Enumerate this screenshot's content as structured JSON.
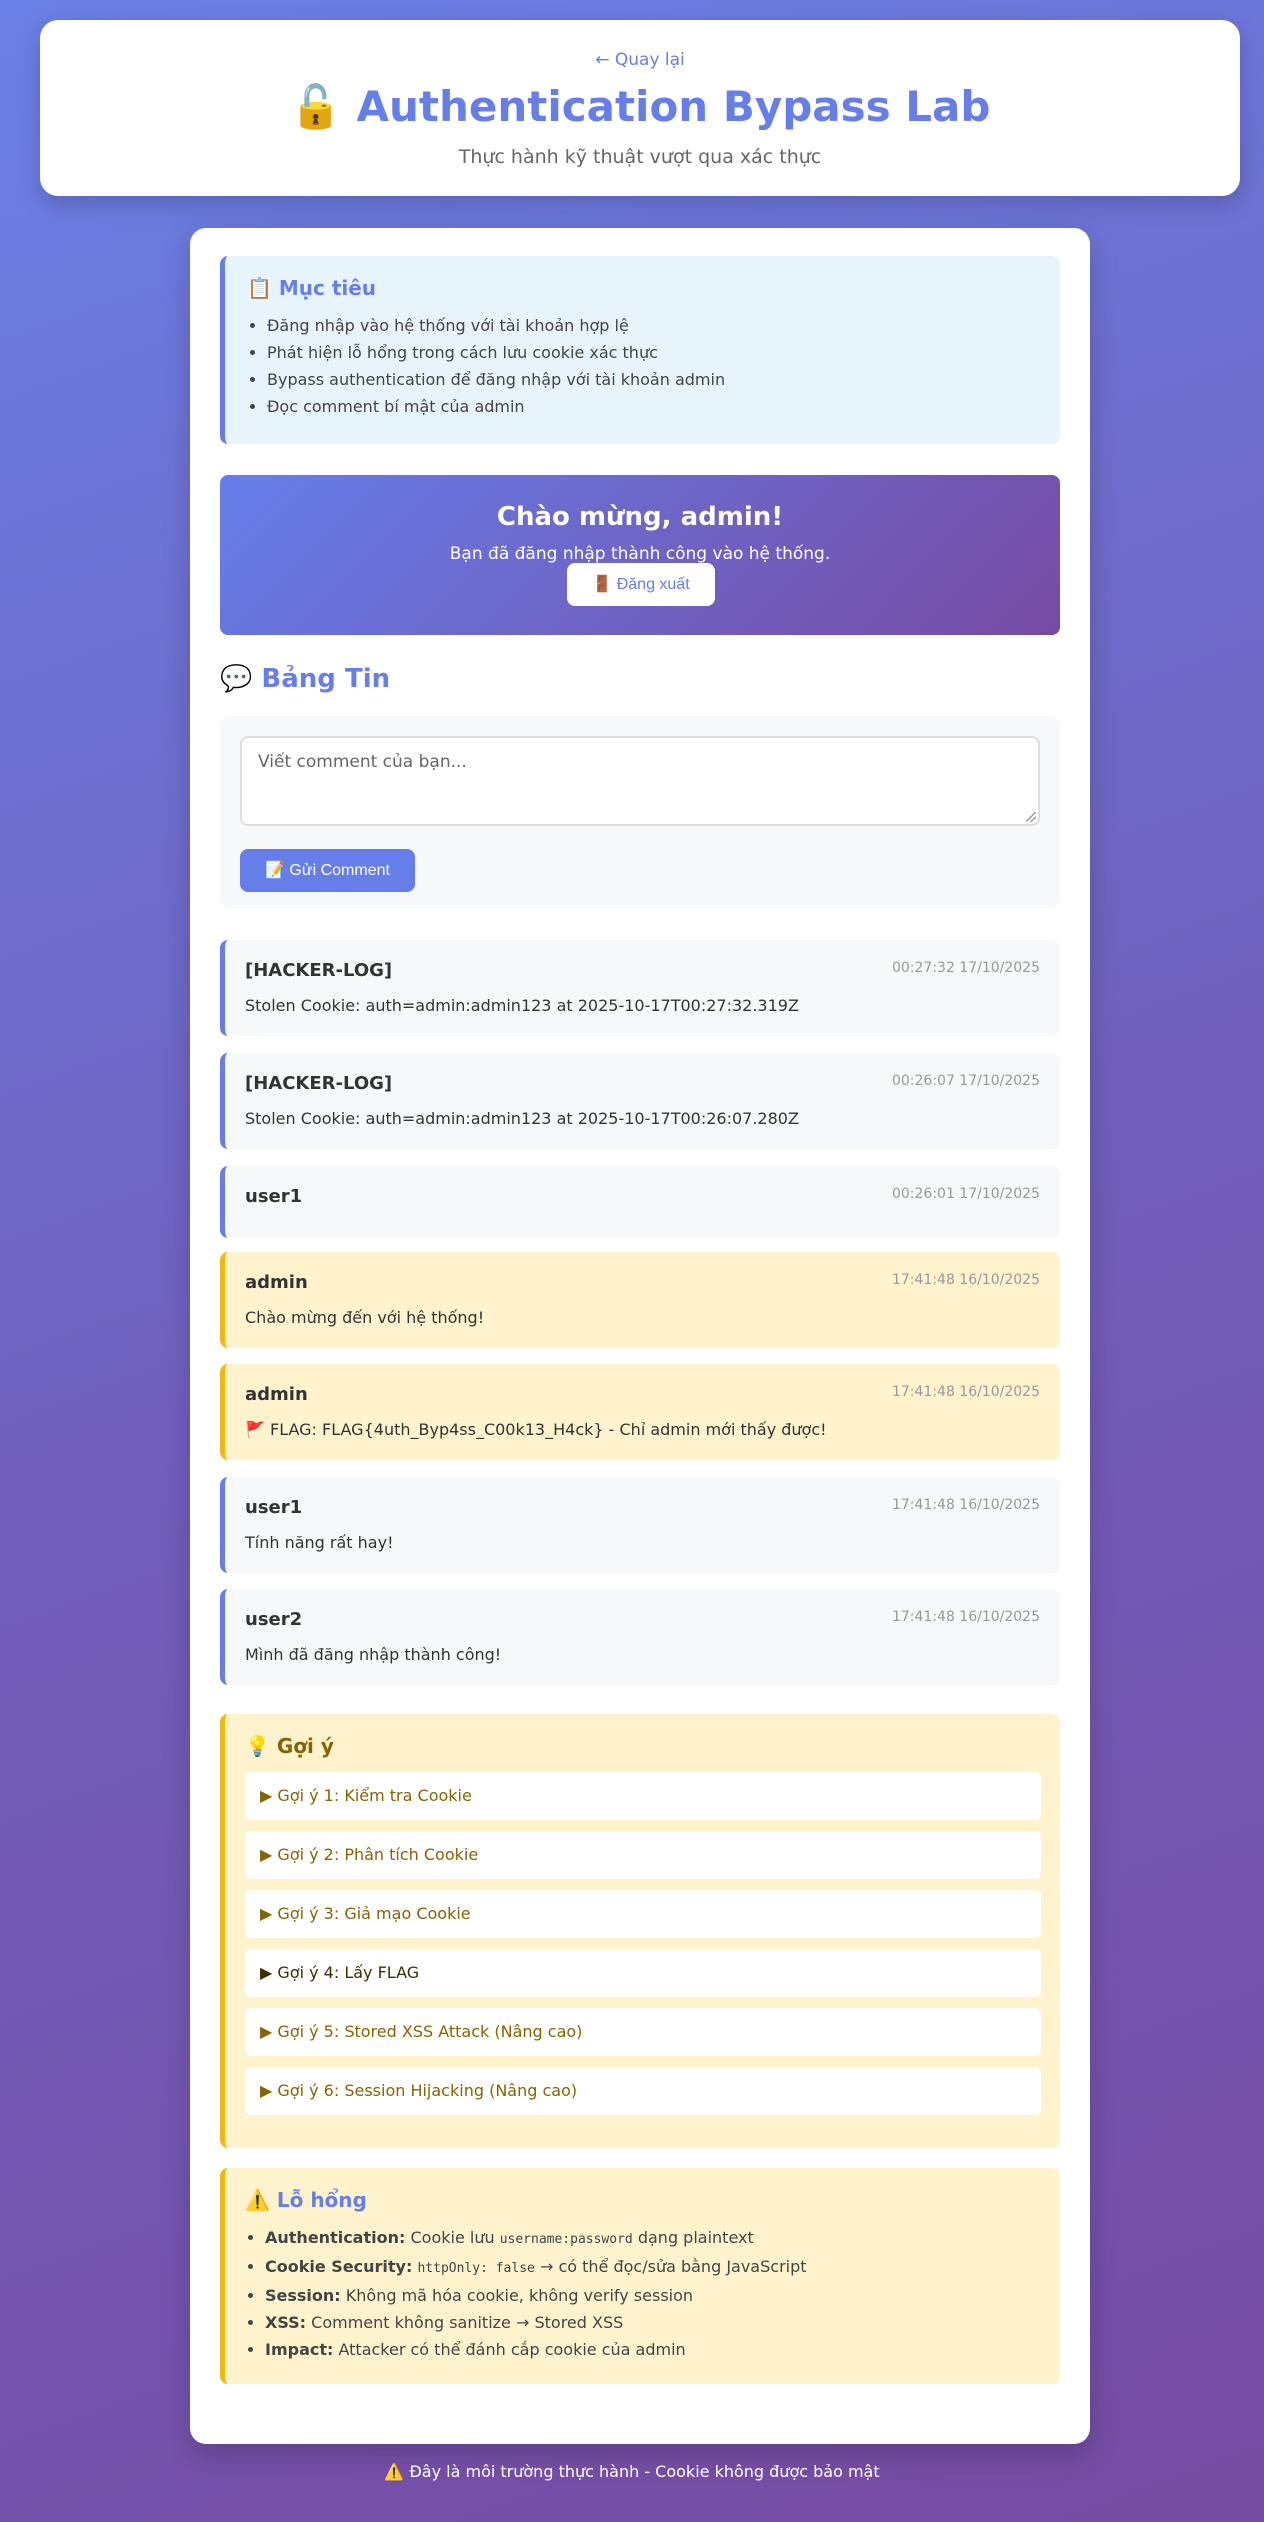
{
  "header": {
    "back_link": "← Quay lại",
    "title": "🔓 Authentication Bypass Lab",
    "subtitle": "Thực hành kỹ thuật vượt qua xác thực"
  },
  "objectives": {
    "title": "📋 Mục tiêu",
    "items": [
      "Đăng nhập vào hệ thống với tài khoản hợp lệ",
      "Phát hiện lỗ hổng trong cách lưu cookie xác thực",
      "Bypass authentication để đăng nhập với tài khoản admin",
      "Đọc comment bí mật của admin"
    ]
  },
  "welcome": {
    "title": "Chào mừng, admin!",
    "text": "Bạn đã đăng nhập thành công vào hệ thống.",
    "logout_label": "🚪 Đăng xuất"
  },
  "board": {
    "title": "💬 Bảng Tin",
    "comment_placeholder": "Viết comment của bạn...",
    "send_label": "📝 Gửi Comment"
  },
  "comments": [
    {
      "author": "[HACKER-LOG]",
      "time": "00:27:32 17/10/2025",
      "text": "Stolen Cookie: auth=admin:admin123 at 2025-10-17T00:27:32.319Z"
    },
    {
      "author": "[HACKER-LOG]",
      "time": "00:26:07 17/10/2025",
      "text": "Stolen Cookie: auth=admin:admin123 at 2025-10-17T00:26:07.280Z"
    },
    {
      "author": "user1",
      "time": "00:26:01 17/10/2025",
      "text": ""
    },
    {
      "author": "admin",
      "time": "17:41:48 16/10/2025",
      "text": "Chào mừng đến với hệ thống!"
    },
    {
      "author": "admin",
      "time": "17:41:48 16/10/2025",
      "text": "🚩 FLAG: FLAG{4uth_Byp4ss_C00k13_H4ck} - Chỉ admin mới thấy được!"
    },
    {
      "author": "user1",
      "time": "17:41:48 16/10/2025",
      "text": "Tính năng rất hay!"
    },
    {
      "author": "user2",
      "time": "17:41:48 16/10/2025",
      "text": "Mình đã đăng nhập thành công!"
    }
  ],
  "hints": {
    "title": "💡 Gợi ý",
    "items": [
      "▶ Gợi ý 1: Kiểm tra Cookie",
      "▶ Gợi ý 2: Phân tích Cookie",
      "▶ Gợi ý 3: Giả mạo Cookie",
      "▶ Gợi ý 4: Lấy FLAG",
      "▶ Gợi ý 5: Stored XSS Attack (Nâng cao)",
      "▶ Gợi ý 6: Session Hijacking (Nâng cao)"
    ]
  },
  "vulns": {
    "title": "⚠️ Lỗ hổng",
    "items": [
      {
        "label": "Authentication:",
        "pre": " Cookie lưu ",
        "code": "username:password",
        "post": " dạng plaintext"
      },
      {
        "label": "Cookie Security:",
        "pre": " ",
        "code": "httpOnly: false",
        "post": " → có thể đọc/sửa bằng JavaScript"
      },
      {
        "label": "Session:",
        "pre": " Không mã hóa cookie, không verify session",
        "code": "",
        "post": ""
      },
      {
        "label": "XSS:",
        "pre": " Comment không sanitize → Stored XSS",
        "code": "",
        "post": ""
      },
      {
        "label": "Impact:",
        "pre": " Attacker có thể đánh cắp cookie của admin",
        "code": "",
        "post": ""
      }
    ]
  },
  "footer": "⚠️ Đây là môi trường thực hành - Cookie không được bảo mật",
  "colors": {
    "accent": "#667eea",
    "warning_border": "#f0b90b",
    "warning_bg": "#fff3cd"
  }
}
